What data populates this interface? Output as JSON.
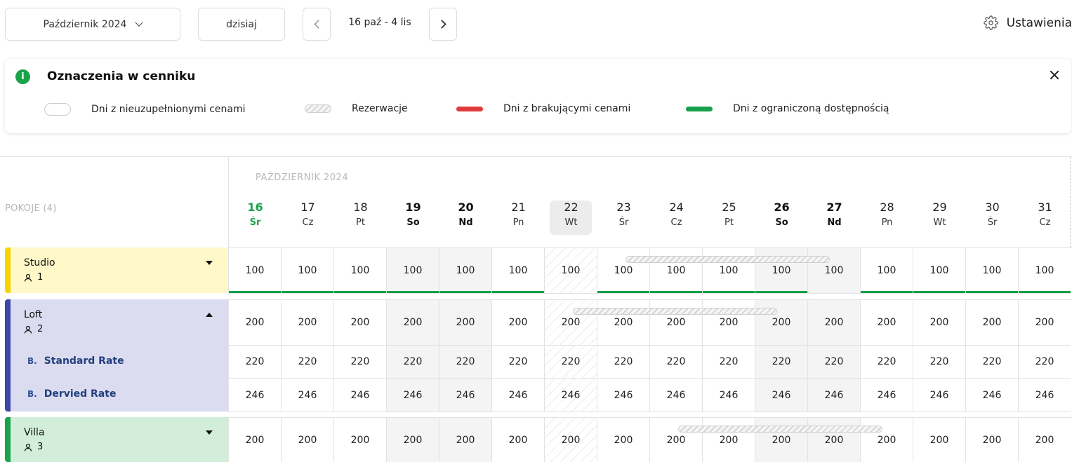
{
  "toolbar": {
    "month": "Październik 2024",
    "today": "dzisiaj",
    "range": "16 paź - 4 lis",
    "settings": "Ustawienia"
  },
  "legend": {
    "title": "Oznaczenia w cenniku",
    "items": [
      {
        "label": "Dni z nieuzupełnionymi cenami",
        "swatch": "empty"
      },
      {
        "label": "Rezerwacje",
        "swatch": "hatch"
      },
      {
        "label": "Dni z brakującymi cenami",
        "swatch": "red"
      },
      {
        "label": "Dni z ograniczoną dostępnością",
        "swatch": "green"
      }
    ]
  },
  "colors": {
    "accent": "#1aa34a",
    "missing": "#e03b3b",
    "limited": "#15a049",
    "studio_bg": "#fff8c8",
    "studio_bar": "#f5d400",
    "loft_bg": "#dcdcf0",
    "loft_bar": "#3b48a8",
    "villa_bg": "#d2eedb",
    "villa_bar": "#1aa34a"
  },
  "grid": {
    "rooms_title": "POKOJE (4)",
    "month_label": "PAŹDZIERNIK 2024",
    "days": [
      {
        "num": "16",
        "wd": "Śr",
        "kind": "today"
      },
      {
        "num": "17",
        "wd": "Cz",
        "kind": ""
      },
      {
        "num": "18",
        "wd": "Pt",
        "kind": ""
      },
      {
        "num": "19",
        "wd": "So",
        "kind": "weekend"
      },
      {
        "num": "20",
        "wd": "Nd",
        "kind": "weekend"
      },
      {
        "num": "21",
        "wd": "Pn",
        "kind": ""
      },
      {
        "num": "22",
        "wd": "Wt",
        "kind": "selected"
      },
      {
        "num": "23",
        "wd": "Śr",
        "kind": ""
      },
      {
        "num": "24",
        "wd": "Cz",
        "kind": ""
      },
      {
        "num": "25",
        "wd": "Pt",
        "kind": ""
      },
      {
        "num": "26",
        "wd": "So",
        "kind": "weekend"
      },
      {
        "num": "27",
        "wd": "Nd",
        "kind": "weekend"
      },
      {
        "num": "28",
        "wd": "Pn",
        "kind": ""
      },
      {
        "num": "29",
        "wd": "Wt",
        "kind": ""
      },
      {
        "num": "30",
        "wd": "Śr",
        "kind": ""
      },
      {
        "num": "31",
        "wd": "Cz",
        "kind": ""
      }
    ]
  },
  "rooms": [
    {
      "name": "Studio",
      "guests": "1",
      "expanded": false,
      "rows": [
        {
          "values": [
            "100",
            "100",
            "100",
            "100",
            "100",
            "100",
            "100",
            "100",
            "100",
            "100",
            "100",
            "100",
            "100",
            "100",
            "100",
            "100"
          ]
        }
      ],
      "limited": [
        1,
        1,
        1,
        1,
        1,
        1,
        0,
        1,
        1,
        1,
        1,
        0,
        1,
        1,
        1,
        1
      ],
      "reservation": {
        "from": 7,
        "to": 10
      }
    },
    {
      "name": "Loft",
      "guests": "2",
      "expanded": true,
      "rows": [
        {
          "values": [
            "200",
            "200",
            "200",
            "200",
            "200",
            "200",
            "200",
            "200",
            "200",
            "200",
            "200",
            "200",
            "200",
            "200",
            "200",
            "200"
          ]
        },
        {
          "label": "Standard Rate",
          "values": [
            "220",
            "220",
            "220",
            "220",
            "220",
            "220",
            "220",
            "220",
            "220",
            "220",
            "220",
            "220",
            "220",
            "220",
            "220",
            "220"
          ]
        },
        {
          "label": "Dervied Rate",
          "values": [
            "246",
            "246",
            "246",
            "246",
            "246",
            "246",
            "246",
            "246",
            "246",
            "246",
            "246",
            "246",
            "246",
            "246",
            "246",
            "246"
          ]
        }
      ],
      "reservation": {
        "from": 6,
        "to": 9
      }
    },
    {
      "name": "Villa",
      "guests": "3",
      "expanded": false,
      "rows": [
        {
          "values": [
            "200",
            "200",
            "200",
            "200",
            "200",
            "200",
            "200",
            "200",
            "200",
            "200",
            "200",
            "200",
            "200",
            "200",
            "200",
            "200"
          ]
        }
      ],
      "reservation": {
        "from": 8,
        "to": 11
      }
    }
  ],
  "icons": {
    "settings": "gear-icon",
    "info": "info-icon",
    "guests": "person-icon",
    "rate": "b-icon"
  }
}
